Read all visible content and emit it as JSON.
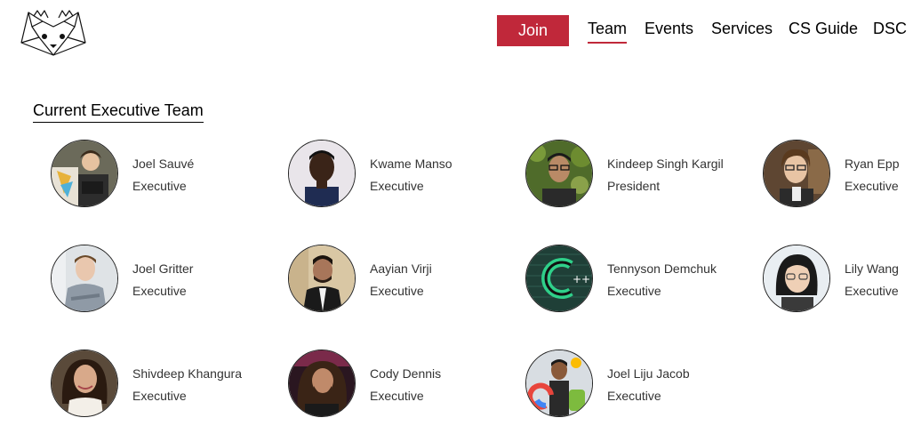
{
  "header": {
    "logo_icon": "fox-mask-logo",
    "join_label": "Join",
    "nav": [
      "Team",
      "Events",
      "Services",
      "CS Guide",
      "DSC"
    ],
    "active_nav": "Team",
    "accent_color": "#c0283a"
  },
  "section": {
    "title": "Current Executive Team"
  },
  "members": [
    {
      "name": "Joel Sauvé",
      "role": "Executive"
    },
    {
      "name": "Kwame Manso",
      "role": "Executive"
    },
    {
      "name": "Kindeep Singh Kargil",
      "role": "President"
    },
    {
      "name": "Ryan Epp",
      "role": "Executive"
    },
    {
      "name": "Joel Gritter",
      "role": "Executive"
    },
    {
      "name": "Aayian Virji",
      "role": "Executive"
    },
    {
      "name": "Tennyson Demchuk",
      "role": "Executive"
    },
    {
      "name": "Lily Wang",
      "role": "Executive"
    },
    {
      "name": "Shivdeep Khangura",
      "role": "Executive"
    },
    {
      "name": "Cody Dennis",
      "role": "Executive"
    },
    {
      "name": "Joel Liju Jacob",
      "role": "Executive"
    }
  ]
}
